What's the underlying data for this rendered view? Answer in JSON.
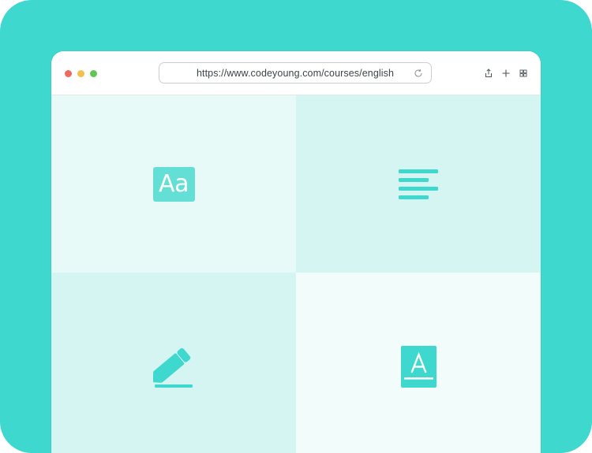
{
  "browser": {
    "url": "https://www.codeyoung.com/courses/english",
    "traffic_lights": [
      "close-dot",
      "minimize-dot",
      "zoom-dot"
    ],
    "toolbar_icons": [
      "share-icon",
      "new-tab-icon",
      "tab-overview-icon"
    ]
  },
  "tiles": [
    {
      "icon": "font-size-icon",
      "glyph": "Aa",
      "bg": "#e8faf8"
    },
    {
      "icon": "align-left-text-icon",
      "bg": "#d4f5f2"
    },
    {
      "icon": "pencil-icon",
      "bg": "#d4f5f2"
    },
    {
      "icon": "text-color-icon",
      "bg": "#f1fcfb"
    }
  ],
  "colors": {
    "frame": "#3ed8cf",
    "accent": "#3ed8cf",
    "accent_light": "#63dfd6"
  }
}
